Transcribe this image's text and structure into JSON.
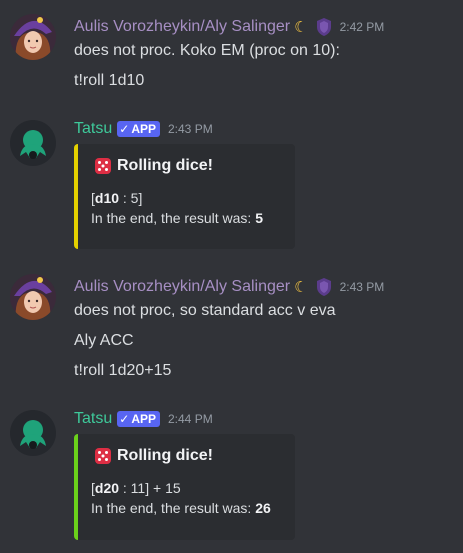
{
  "messages": [
    {
      "author": "Aulis Vorozheykin/Aly Salinger",
      "moon_icon": "crescent-moon-icon",
      "role_icon": "shield-icon",
      "timestamp": "2:42 PM",
      "lines": [
        "does not proc. Koko EM (proc on 10):",
        "t!roll 1d10"
      ]
    },
    {
      "author": "Tatsu",
      "app_tag": "APP",
      "timestamp": "2:43 PM",
      "embed": {
        "accent_color": "#e5d100",
        "title": "Rolling dice!",
        "roll_open": "[",
        "roll_die": "d10",
        "roll_rest": " : 5]",
        "roll_mod": "",
        "result_label": "In the end, the result was: ",
        "result": "5"
      }
    },
    {
      "author": "Aulis Vorozheykin/Aly Salinger",
      "moon_icon": "crescent-moon-icon",
      "role_icon": "shield-icon",
      "timestamp": "2:43 PM",
      "lines": [
        "does not proc, so standard acc v eva",
        "Aly ACC",
        "t!roll 1d20+15"
      ]
    },
    {
      "author": "Tatsu",
      "app_tag": "APP",
      "timestamp": "2:44 PM",
      "embed": {
        "accent_color": "#6bd11b",
        "title": "Rolling dice!",
        "roll_open": "[",
        "roll_die": "d20",
        "roll_rest": " : 11]",
        "roll_mod": " + 15",
        "result_label": "In the end, the result was: ",
        "result": "26"
      }
    }
  ]
}
